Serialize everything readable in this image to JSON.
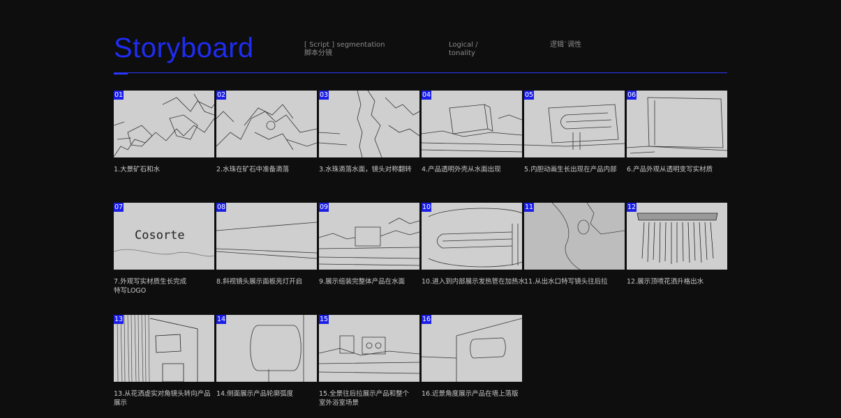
{
  "header": {
    "title": "Storyboard",
    "col1_line1": "[ Script ] segmentation",
    "col1_line2": "脚本分镜",
    "col2_line1": "Logical /",
    "col2_line2": "tonality",
    "col3_line1": "逻辑`调性"
  },
  "frames": [
    {
      "num": "01",
      "caption": "1.大景矿石和水"
    },
    {
      "num": "02",
      "caption": "2.水珠在矿石中准备滴落"
    },
    {
      "num": "03",
      "caption": "3.水珠滴落水面，镜头对称翻转"
    },
    {
      "num": "04",
      "caption": "4.产品透明外壳从水面出现"
    },
    {
      "num": "05",
      "caption": "5.内胆动画生长出现在产品内部"
    },
    {
      "num": "06",
      "caption": "6.产品外观从透明变写实材质"
    },
    {
      "num": "07",
      "caption": "7.外观写实材质生长完成\n特写LOGO",
      "logo": "Cosorte"
    },
    {
      "num": "08",
      "caption": "8.斜视镜头展示面板亮灯开启"
    },
    {
      "num": "09",
      "caption": "9.展示组装完整体产品在水面"
    },
    {
      "num": "10",
      "caption": "10.进入到内部展示发热管在加热水"
    },
    {
      "num": "11",
      "caption": "11.从出水口特写镜头往后拉"
    },
    {
      "num": "12",
      "caption": "12.展示顶喷花洒升格出水"
    },
    {
      "num": "13",
      "caption": "13.从花洒虚实对角镜头转向产品\n展示"
    },
    {
      "num": "14",
      "caption": "14.侧面展示产品轮廓弧度"
    },
    {
      "num": "15",
      "caption": "15.全景往后拉展示产品和整个\n室外浴室场景"
    },
    {
      "num": "16",
      "caption": "16.近景角度展示产品在墙上落版"
    }
  ]
}
